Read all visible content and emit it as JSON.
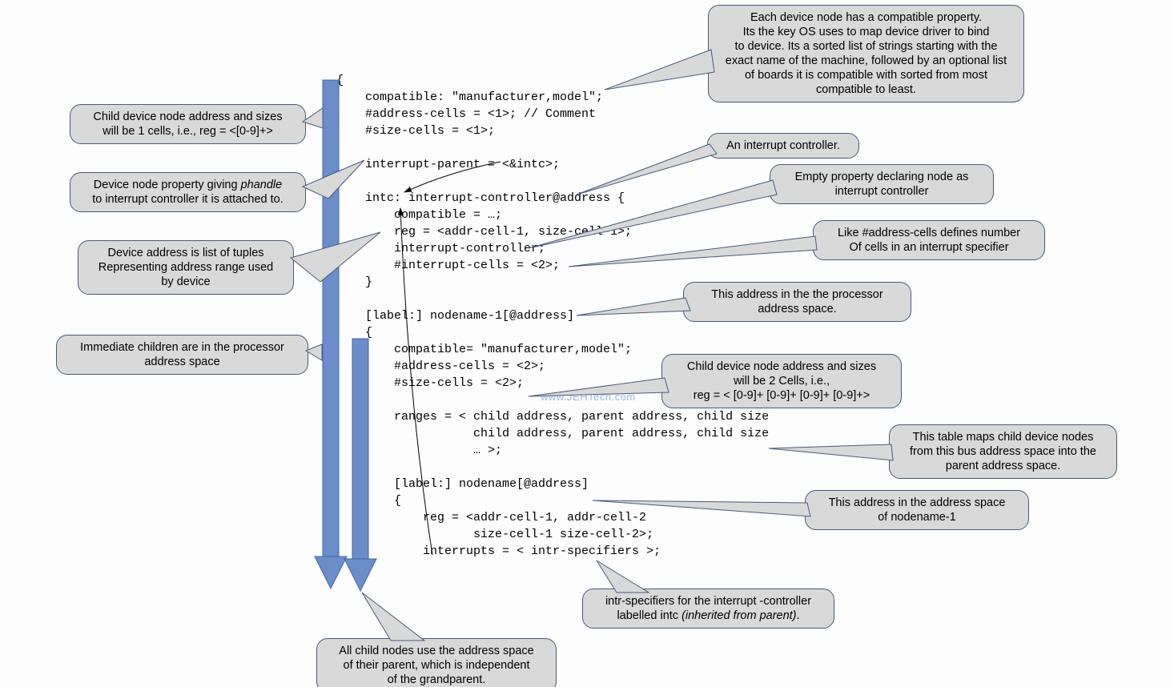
{
  "code": "{\n    compatible: \"manufacturer,model\";\n    #address-cells = <1>; // Comment\n    #size-cells = <1>;\n\n    interrupt-parent = <&intc>;\n\n    intc: interrupt-controller@address {\n        compatible = …;\n        reg = <addr-cell-1, size-cell-1>;\n        interrupt-controller;\n        #interrupt-cells = <2>;\n    }\n\n    [label:] nodename-1[@address]\n    {\n        compatible= \"manufacturer,model\";\n        #address-cells = <2>;\n        #size-cells = <2>;\n\n        ranges = < child address, parent address, child size\n                   child address, parent address, child size\n                   … >;\n\n        [label:] nodename[@address]\n        {\n            reg = <addr-cell-1, addr-cell-2\n                   size-cell-1 size-cell-2>;\n            interrupts = < intr-specifiers >;",
  "watermark": "www.JEHTech.com",
  "callouts": {
    "child1": "Child device node address and sizes\nwill be 1 cells, i.e., reg = <[0-9]+>",
    "phandle_pre": "Device node property giving ",
    "phandle_em": "phandle",
    "phandle_post": "\nto interrupt controller it is attached to.",
    "devaddr": "Device address is list of tuples\nRepresenting address range used\nby device",
    "immchildren": "Immediate children are in the processor\naddress space",
    "compat": "Each device node has a compatible property.\nIts the key OS uses to map device driver to bind\nto device. Its a sorted list of strings starting with the\nexact name of the machine, followed by an optional list\nof boards it is compatible with sorted from most\ncompatible to least.",
    "intctrl": "An interrupt controller.",
    "emptyprop": "Empty property declaring node as\ninterrupt controller",
    "likeaddr": "Like #address-cells defines number\nOf cells in an interrupt specifier",
    "procaddr": "This address in the the processor\naddress space.",
    "child2": "Child device node address and sizes\nwill be 2 Cells, i.e.,\nreg = < [0-9]+ [0-9]+ [0-9]+ [0-9]+>",
    "rangesmap": "This table maps child device nodes\nfrom this bus address space into the\nparent address space.",
    "addrnode1": "This address in the address space\nof nodename-1",
    "intrspec_pre": "intr-specifiers for the interrupt -controller\nlabelled intc ",
    "intrspec_em": "(inherited from parent)",
    "intrspec_post": ".",
    "allchild": "All child nodes use the address space\nof their parent, which is independent\nof the grandparent."
  }
}
